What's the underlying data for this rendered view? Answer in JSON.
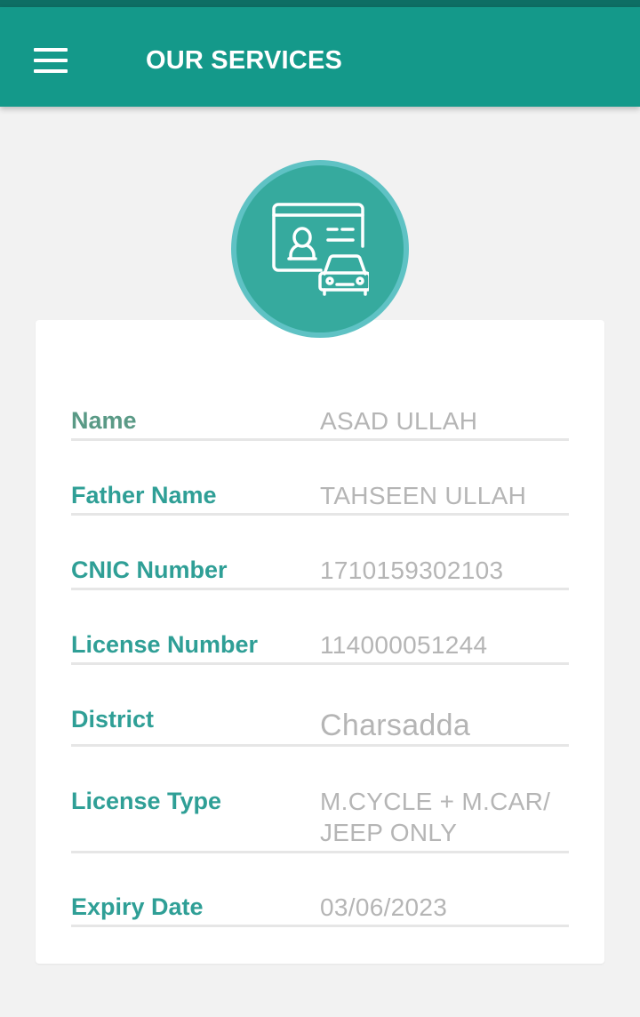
{
  "app_bar": {
    "title": "OUR SERVICES",
    "menu_icon": "hamburger-menu-icon",
    "color": "#14998a"
  },
  "service_icon": {
    "name": "driving-license-icon",
    "color": "#36aa9e"
  },
  "details": [
    {
      "label": "Name",
      "value": "ASAD ULLAH"
    },
    {
      "label": "Father Name",
      "value": "TAHSEEN ULLAH"
    },
    {
      "label": "CNIC Number",
      "value": "1710159302103"
    },
    {
      "label": "License Number",
      "value": "114000051244"
    },
    {
      "label": "District",
      "value": "Charsadda"
    },
    {
      "label": "License Type",
      "value": "M.CYCLE + M.CAR/ JEEP ONLY"
    },
    {
      "label": "Expiry Date",
      "value": "03/06/2023"
    }
  ]
}
